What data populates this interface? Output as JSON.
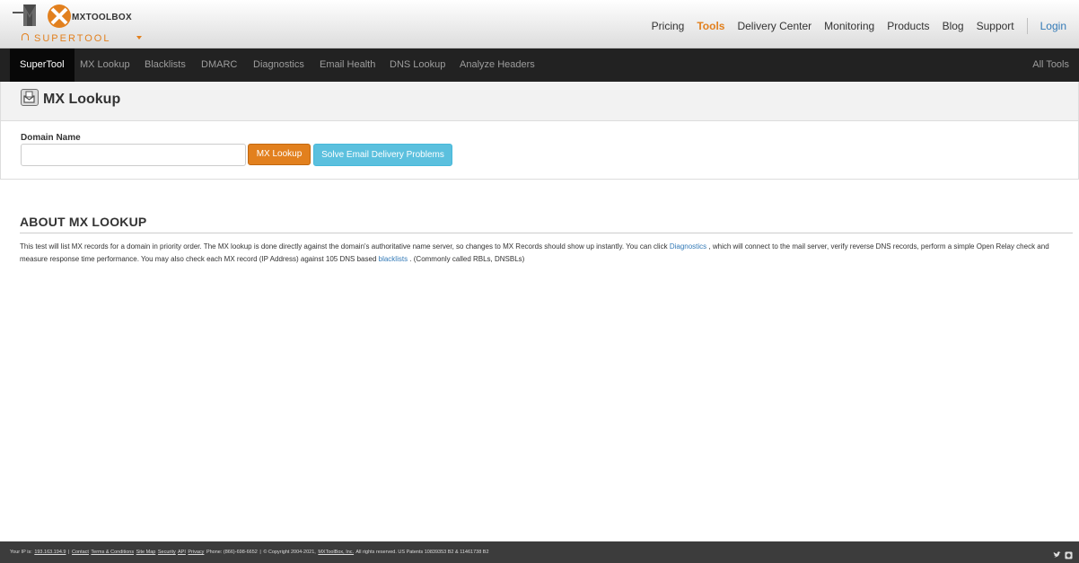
{
  "header": {
    "logo": {
      "wordmark": "MXTOOLBOX",
      "subtitle": "SUPERTOOL",
      "icon": "mxtoolbox-logo"
    },
    "nav": [
      {
        "label": "Pricing",
        "active": false
      },
      {
        "label": "Tools",
        "active": true
      },
      {
        "label": "Delivery Center",
        "active": false
      },
      {
        "label": "Monitoring",
        "active": false
      },
      {
        "label": "Products",
        "active": false
      },
      {
        "label": "Blog",
        "active": false
      },
      {
        "label": "Support",
        "active": false
      }
    ],
    "login_label": "Login"
  },
  "toolnav": {
    "items": [
      {
        "label": "SuperTool",
        "active": true
      },
      {
        "label": "MX Lookup",
        "active": false
      },
      {
        "label": "Blacklists",
        "active": false
      },
      {
        "label": "DMARC",
        "active": false
      },
      {
        "label": "Diagnostics",
        "active": false
      },
      {
        "label": "Email Health",
        "active": false
      },
      {
        "label": "DNS Lookup",
        "active": false
      },
      {
        "label": "Analyze Headers",
        "active": false
      }
    ],
    "all_tools": "All Tools"
  },
  "page": {
    "title": "MX Lookup",
    "icon": "mail-envelope-icon"
  },
  "form": {
    "domain_label": "Domain Name",
    "domain_value": "",
    "domain_placeholder": "",
    "lookup_button": "MX Lookup",
    "solve_button": "Solve Email Delivery Problems"
  },
  "about": {
    "title": "ABOUT MX LOOKUP",
    "text_1": "This test will list MX records for a domain in priority order. The MX lookup is done directly against the domain's authoritative name server, so changes to MX Records should show up instantly. You can click ",
    "link_diagnostics": "Diagnostics",
    "text_2": " , which will connect to the mail server, verify reverse DNS records, perform a simple Open Relay check and measure response time performance. You may also check each MX record (IP Address) against 105 DNS based ",
    "link_blacklists": "blacklists",
    "text_3": " . (Commonly called RBLs, DNSBLs)"
  },
  "footer": {
    "ip_label": "Your IP is:",
    "ip": "193.163.194.9",
    "sep": "|",
    "contact": "Contact",
    "terms": "Terms & Conditions",
    "sitemap": "Site Map",
    "security": "Security",
    "api": "API",
    "privacy": "Privacy",
    "phone": "Phone: (866)-698-6652",
    "copyright": "© Copyright 2004-2021,",
    "company": "MXToolBox, Inc.",
    "rights": "All rights reserved. US Patents 10839353 B2 & 11461738 B2",
    "icons": [
      "twitter-icon",
      "github-icon"
    ]
  },
  "colors": {
    "accent_orange": "#e2801e",
    "info_blue": "#5bc0de",
    "link_blue": "#337ab7",
    "nav_dark": "#222222",
    "footer_dark": "#3c3c3c"
  }
}
